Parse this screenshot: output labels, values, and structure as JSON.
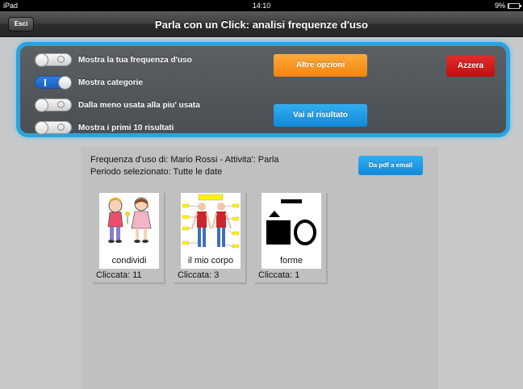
{
  "status_bar": {
    "device": "iPad",
    "time": "14:10",
    "battery_text": "9%",
    "battery_level": 0.09
  },
  "nav": {
    "back_label": "Esci",
    "title": "Parla con un Click: analisi frequenze d'uso"
  },
  "options": {
    "toggles": [
      {
        "label": "Mostra la tua frequenza d'uso",
        "on": false
      },
      {
        "label": "Mostra categorie",
        "on": true
      },
      {
        "label": "Dalla meno usata alla piu' usata",
        "on": false
      },
      {
        "label": "Mostra i primi 10 risultati",
        "on": false
      }
    ],
    "more_options_label": "Altre opzioni",
    "reset_label": "Azzera",
    "go_to_result_label": "Vai al risultato"
  },
  "results": {
    "line1": "Frequenza d'uso di: Mario Rossi - Attivita': Parla",
    "line2": "Periodo selezionato: Tutte le date",
    "pdf_button_label": "Da pdf a email",
    "cards": [
      {
        "name": "condividi",
        "count_text": "Cliccata: 11"
      },
      {
        "name": "il mio corpo",
        "count_text": "Cliccata: 3"
      },
      {
        "name": "forme",
        "count_text": "Cliccata: 1"
      }
    ]
  },
  "colors": {
    "panel_border": "#2aa3df",
    "orange_button": "#f28410",
    "red_button": "#c10f0f",
    "blue_button": "#1189d8",
    "toggle_on": "#1a5fc2"
  }
}
